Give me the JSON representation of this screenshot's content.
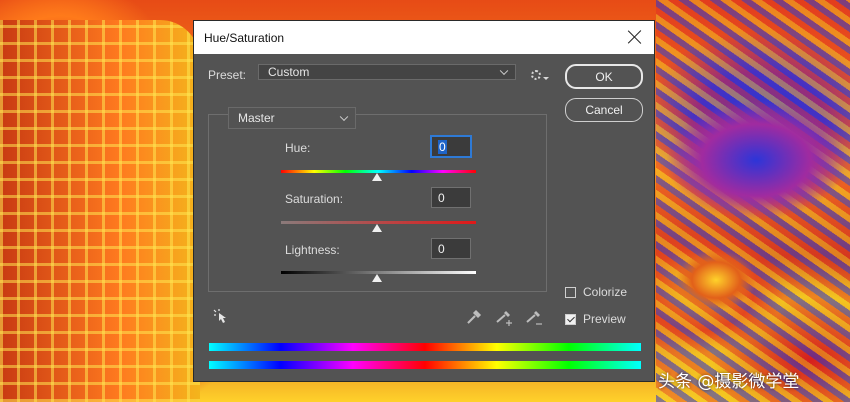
{
  "background": {
    "watermark": "头条 @摄影微学堂"
  },
  "dialog": {
    "title": "Hue/Saturation",
    "preset_label": "Preset:",
    "preset_value": "Custom",
    "ok_label": "OK",
    "cancel_label": "Cancel",
    "channel_value": "Master",
    "hue_label": "Hue:",
    "hue_value": "0",
    "saturation_label": "Saturation:",
    "saturation_value": "0",
    "lightness_label": "Lightness:",
    "lightness_value": "0",
    "colorize_label": "Colorize",
    "colorize_checked": false,
    "preview_label": "Preview",
    "preview_checked": true
  },
  "icons": [
    "gear-icon",
    "close-icon",
    "targeted-adjustment-icon",
    "eyedropper-icon",
    "eyedropper-plus-icon",
    "eyedropper-minus-icon",
    "chevron-down-icon"
  ],
  "colors": {
    "dialog_bg": "#535353",
    "accent_focus": "#2e7ad6"
  }
}
